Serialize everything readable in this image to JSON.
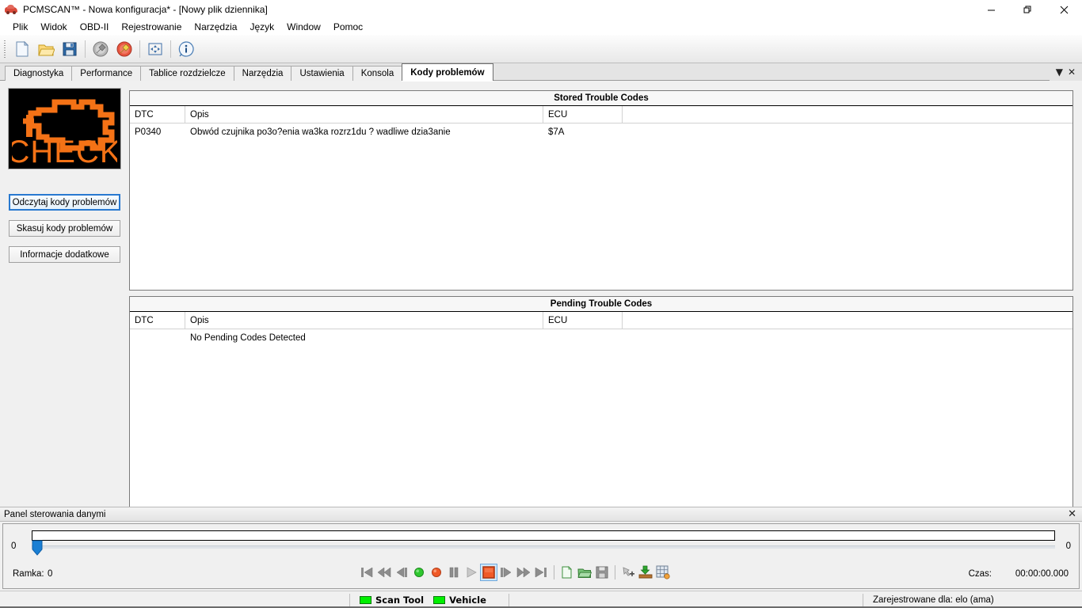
{
  "window": {
    "title": "PCMSCAN™ - Nowa konfiguracja* - [Nowy plik dziennika]",
    "app_icon": "car-icon",
    "minimize": "—",
    "restore": "❐",
    "close": "✕"
  },
  "menu": {
    "items": [
      {
        "label": "Plik"
      },
      {
        "label": "Widok"
      },
      {
        "label": "OBD-II"
      },
      {
        "label": "Rejestrowanie"
      },
      {
        "label": "Narzędzia"
      },
      {
        "label": "Język"
      },
      {
        "label": "Window"
      },
      {
        "label": "Pomoc"
      }
    ]
  },
  "toolbar": {
    "buttons": [
      {
        "name": "new-file-icon"
      },
      {
        "name": "open-file-icon"
      },
      {
        "name": "save-file-icon"
      },
      {
        "name": "disconnect-plug-icon"
      },
      {
        "name": "connect-plug-icon"
      },
      {
        "name": "fit-window-icon"
      },
      {
        "name": "info-icon"
      }
    ]
  },
  "tabs": {
    "items": [
      {
        "label": "Diagnostyka",
        "active": false
      },
      {
        "label": "Performance",
        "active": false
      },
      {
        "label": "Tablice rozdzielcze",
        "active": false
      },
      {
        "label": "Narzędzia",
        "active": false
      },
      {
        "label": "Ustawienia",
        "active": false
      },
      {
        "label": "Konsola",
        "active": false
      },
      {
        "label": "Kody problemów",
        "active": true
      }
    ],
    "dropdown_glyph": "▼",
    "close_glyph": "✕"
  },
  "sidebar": {
    "check_engine_text": "CHECK",
    "check_engine_color": "#f47216",
    "buttons": [
      {
        "label": "Odczytaj kody problemów",
        "focused": true
      },
      {
        "label": "Skasuj kody problemów",
        "focused": false
      },
      {
        "label": "Informacje dodatkowe",
        "focused": false
      }
    ]
  },
  "stored_codes": {
    "title": "Stored Trouble Codes",
    "columns": [
      "DTC",
      "Opis",
      "ECU",
      ""
    ],
    "rows": [
      {
        "dtc": "P0340",
        "opis": "Obwód czujnika po3o?enia wa3ka rozrz1du ? wadliwe dzia3anie",
        "ecu": "$7A",
        "extra": ""
      }
    ]
  },
  "pending_codes": {
    "title": "Pending Trouble Codes",
    "columns": [
      "DTC",
      "Opis",
      "ECU",
      ""
    ],
    "rows": [
      {
        "dtc": "",
        "opis": "No Pending Codes Detected",
        "ecu": "",
        "extra": ""
      }
    ]
  },
  "data_panel": {
    "title": "Panel sterowania danymi",
    "close_glyph": "✕",
    "slider_min_label": "0",
    "slider_max_label": "0",
    "slider_value": 0,
    "frame_label": "Ramka:",
    "frame_value": "0",
    "time_label": "Czas:",
    "time_value": "00:00:00.000",
    "transport": [
      {
        "name": "skip-to-start-icon",
        "selected": false
      },
      {
        "name": "rewind-icon",
        "selected": false
      },
      {
        "name": "step-back-icon",
        "selected": false
      },
      {
        "name": "connect-green-icon",
        "selected": false
      },
      {
        "name": "record-icon",
        "selected": false
      },
      {
        "name": "pause-icon",
        "selected": false
      },
      {
        "name": "play-icon",
        "selected": false
      },
      {
        "name": "stop-icon",
        "selected": true
      },
      {
        "name": "step-forward-icon",
        "selected": false
      },
      {
        "name": "fast-forward-icon",
        "selected": false
      },
      {
        "name": "skip-to-end-icon",
        "selected": false
      },
      {
        "name": "new-log-icon",
        "selected": false
      },
      {
        "name": "open-log-icon",
        "selected": false
      },
      {
        "name": "save-log-icon",
        "selected": false
      },
      {
        "name": "add-marker-icon",
        "selected": false
      },
      {
        "name": "export-icon",
        "selected": false
      },
      {
        "name": "grid-view-icon",
        "selected": false
      }
    ]
  },
  "statusbar": {
    "scan_tool_label": "Scan Tool",
    "vehicle_label": "Vehicle",
    "registered_text": "Zarejestrowane dla: elo (ama)",
    "led_color": "#00f000"
  }
}
